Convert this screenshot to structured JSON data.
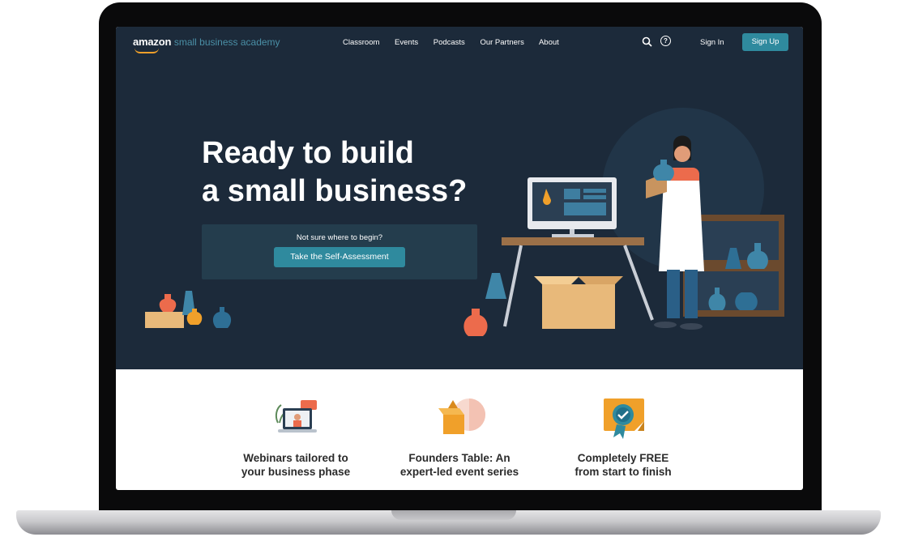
{
  "header": {
    "logo_brand": "amazon",
    "logo_rest": "small business academy",
    "nav": [
      "Classroom",
      "Events",
      "Podcasts",
      "Our Partners",
      "About"
    ],
    "help_glyph": "?",
    "signin_label": "Sign In",
    "signup_label": "Sign Up"
  },
  "hero": {
    "headline_line1": "Ready to build",
    "headline_line2": "a small business?",
    "prompt": "Not sure where to begin?",
    "cta_label": "Take the Self-Assessment"
  },
  "features": [
    {
      "line1": "Webinars tailored to",
      "line2": "your business phase",
      "icon": "webinar-laptop-icon"
    },
    {
      "line1": "Founders Table: An",
      "line2": "expert-led event series",
      "icon": "founders-table-icon"
    },
    {
      "line1": "Completely FREE",
      "line2": "from start to finish",
      "icon": "free-badge-icon"
    }
  ],
  "colors": {
    "hero_bg": "#1c2a3a",
    "accent": "#2f8a9e",
    "logo_teal": "#4a8fa6",
    "smile_orange": "#f0a02a"
  }
}
